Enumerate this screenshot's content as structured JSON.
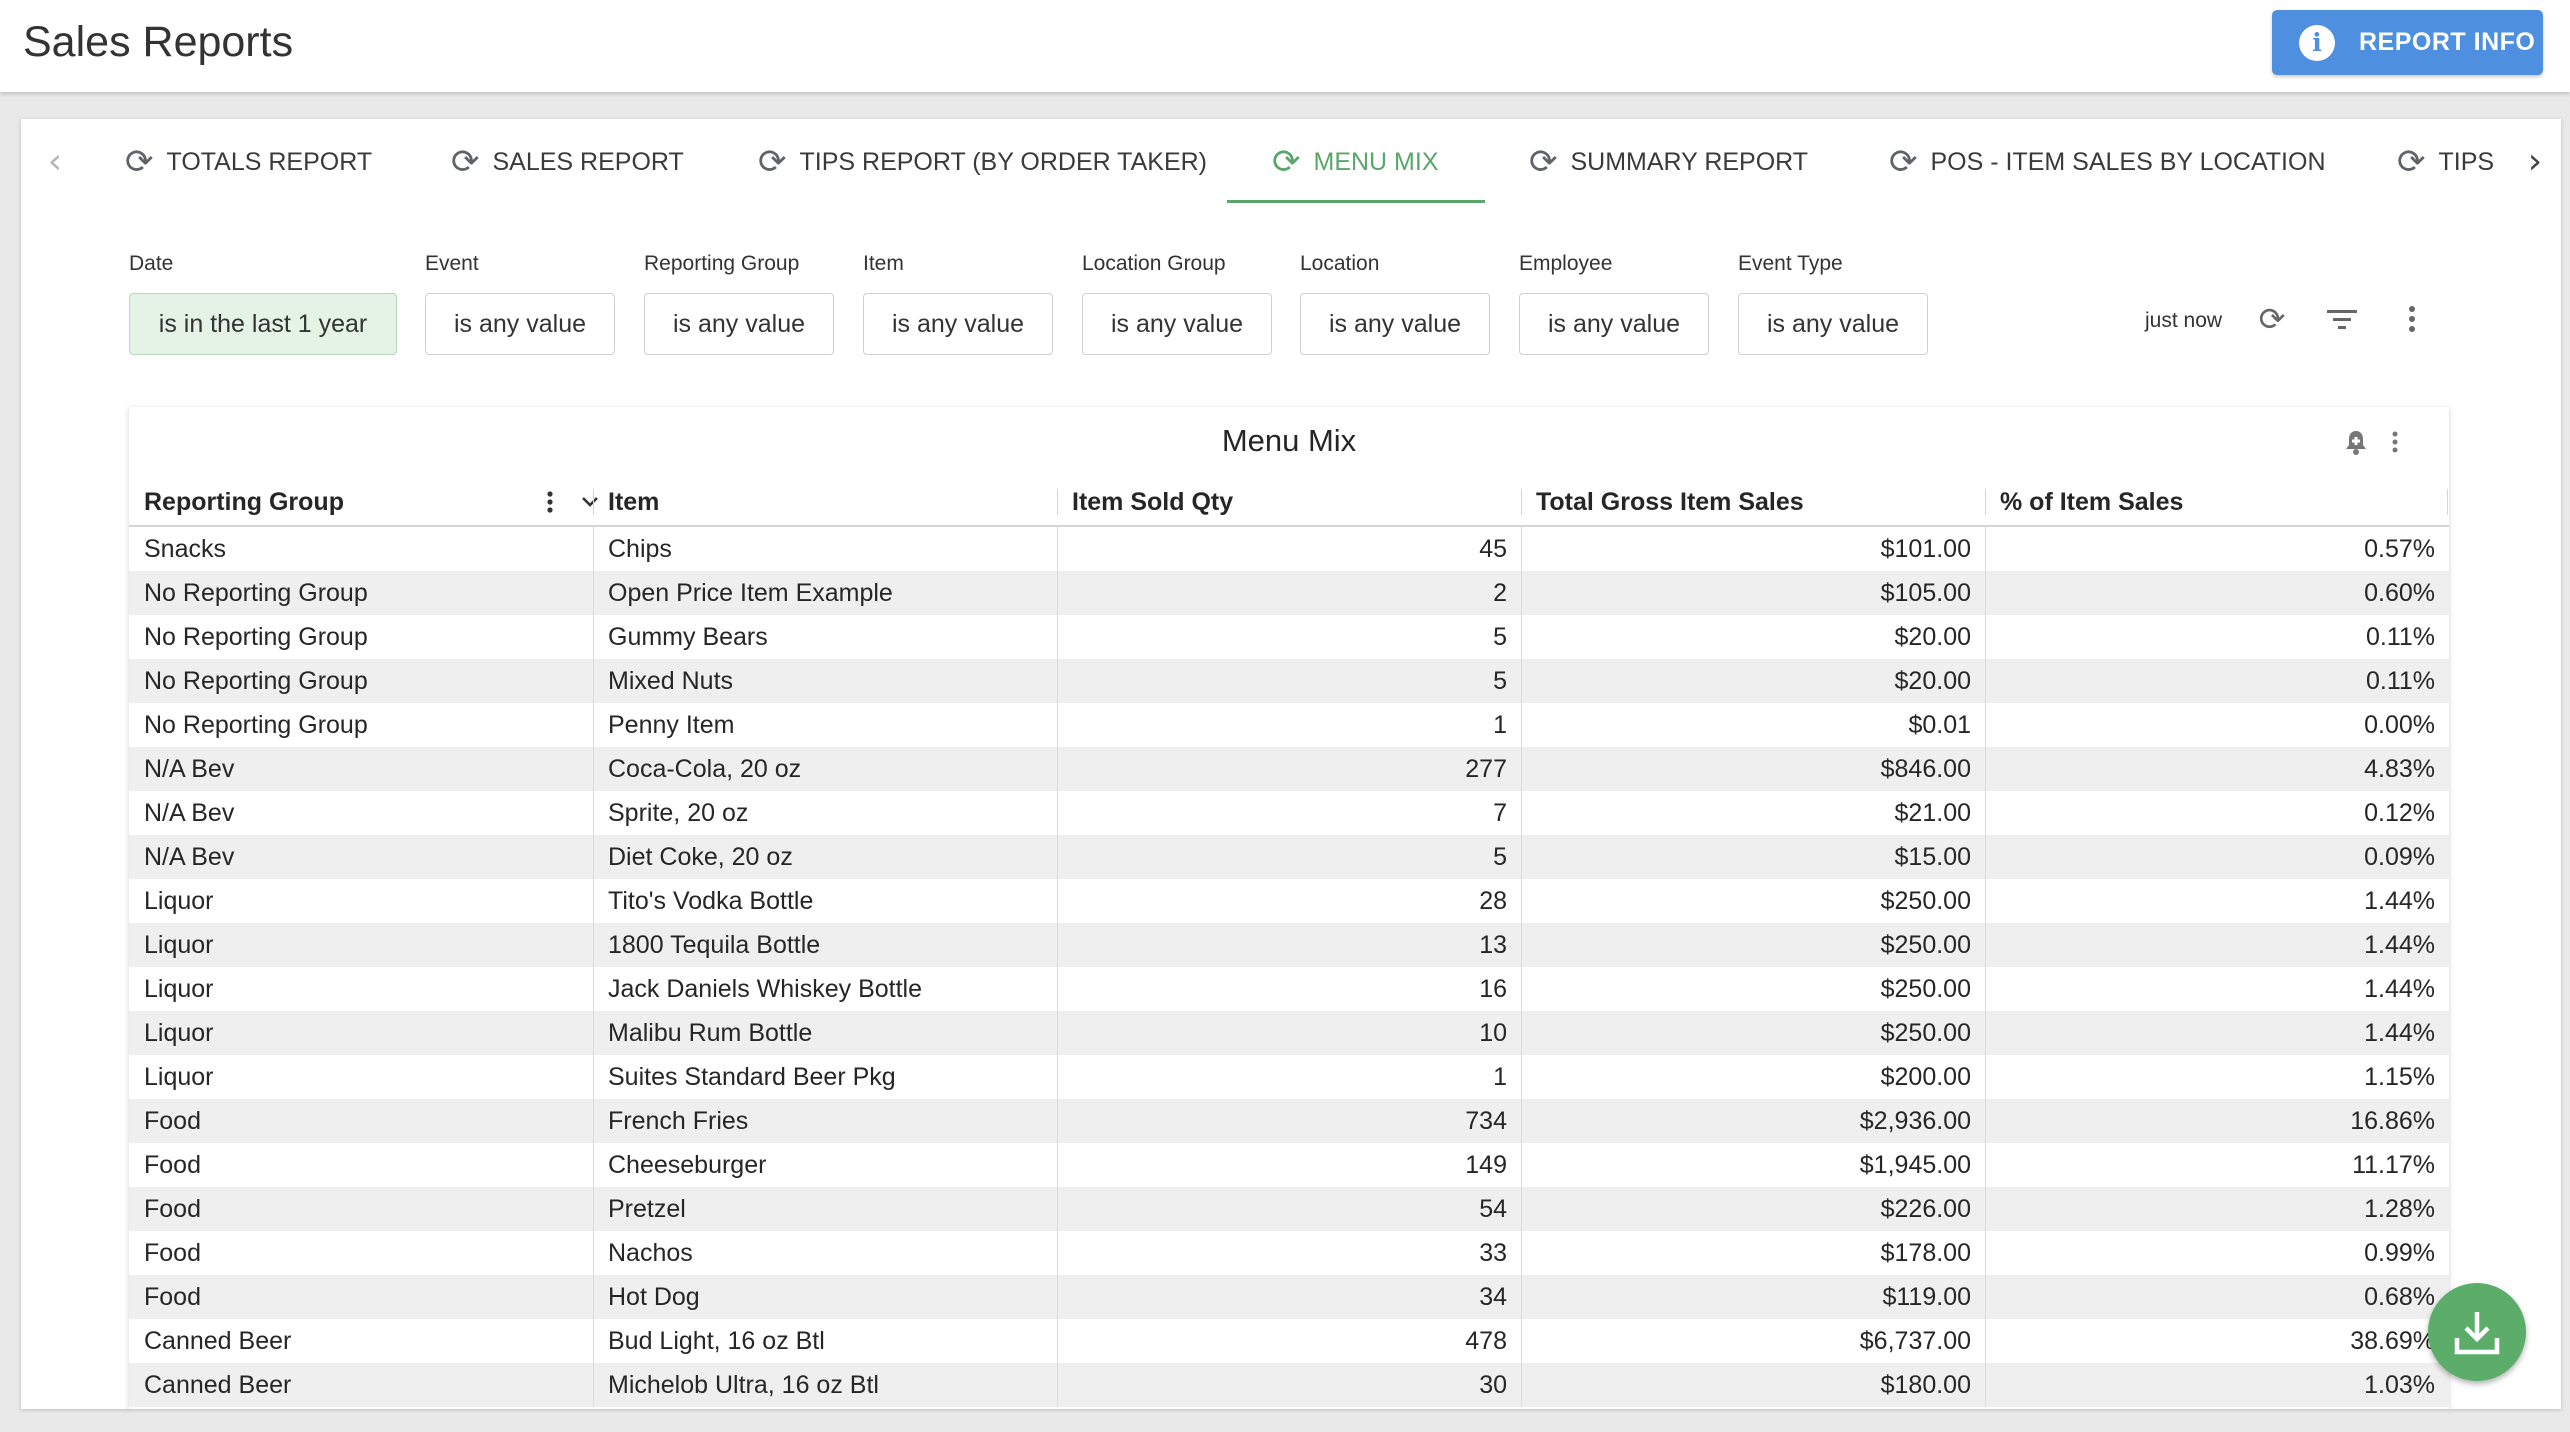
{
  "header": {
    "title": "Sales Reports",
    "report_info_label": "REPORT INFO"
  },
  "tabs": [
    {
      "label": "TOTALS REPORT",
      "active": false
    },
    {
      "label": "SALES REPORT",
      "active": false
    },
    {
      "label": "TIPS REPORT (BY ORDER TAKER)",
      "active": false
    },
    {
      "label": "MENU MIX",
      "active": true
    },
    {
      "label": "SUMMARY REPORT",
      "active": false
    },
    {
      "label": "POS - ITEM SALES BY LOCATION",
      "active": false
    },
    {
      "label": "TIPS",
      "active": false
    }
  ],
  "filters": [
    {
      "label": "Date",
      "value": "is in the last 1 year",
      "active": true
    },
    {
      "label": "Event",
      "value": "is any value",
      "active": false
    },
    {
      "label": "Reporting Group",
      "value": "is any value",
      "active": false
    },
    {
      "label": "Item",
      "value": "is any value",
      "active": false
    },
    {
      "label": "Location Group",
      "value": "is any value",
      "active": false
    },
    {
      "label": "Location",
      "value": "is any value",
      "active": false
    },
    {
      "label": "Employee",
      "value": "is any value",
      "active": false
    },
    {
      "label": "Event Type",
      "value": "is any value",
      "active": false
    }
  ],
  "toolbar": {
    "refresh_status": "just now"
  },
  "table": {
    "title": "Menu Mix",
    "columns": [
      "Reporting Group",
      "Item",
      "Item Sold Qty",
      "Total Gross Item Sales",
      "% of Item Sales"
    ],
    "rows": [
      [
        "Snacks",
        "Chips",
        "45",
        "$101.00",
        "0.57%"
      ],
      [
        "No Reporting Group",
        "Open Price Item Example",
        "2",
        "$105.00",
        "0.60%"
      ],
      [
        "No Reporting Group",
        "Gummy Bears",
        "5",
        "$20.00",
        "0.11%"
      ],
      [
        "No Reporting Group",
        "Mixed Nuts",
        "5",
        "$20.00",
        "0.11%"
      ],
      [
        "No Reporting Group",
        "Penny Item",
        "1",
        "$0.01",
        "0.00%"
      ],
      [
        "N/A Bev",
        "Coca-Cola, 20 oz",
        "277",
        "$846.00",
        "4.83%"
      ],
      [
        "N/A Bev",
        "Sprite, 20 oz",
        "7",
        "$21.00",
        "0.12%"
      ],
      [
        "N/A Bev",
        "Diet Coke, 20 oz",
        "5",
        "$15.00",
        "0.09%"
      ],
      [
        "Liquor",
        "Tito's Vodka Bottle",
        "28",
        "$250.00",
        "1.44%"
      ],
      [
        "Liquor",
        "1800 Tequila Bottle",
        "13",
        "$250.00",
        "1.44%"
      ],
      [
        "Liquor",
        "Jack Daniels Whiskey Bottle",
        "16",
        "$250.00",
        "1.44%"
      ],
      [
        "Liquor",
        "Malibu Rum Bottle",
        "10",
        "$250.00",
        "1.44%"
      ],
      [
        "Liquor",
        "Suites Standard Beer Pkg",
        "1",
        "$200.00",
        "1.15%"
      ],
      [
        "Food",
        "French Fries",
        "734",
        "$2,936.00",
        "16.86%"
      ],
      [
        "Food",
        "Cheeseburger",
        "149",
        "$1,945.00",
        "11.17%"
      ],
      [
        "Food",
        "Pretzel",
        "54",
        "$226.00",
        "1.28%"
      ],
      [
        "Food",
        "Nachos",
        "33",
        "$178.00",
        "0.99%"
      ],
      [
        "Food",
        "Hot Dog",
        "34",
        "$119.00",
        "0.68%"
      ],
      [
        "Canned Beer",
        "Bud Light, 16 oz Btl",
        "478",
        "$6,737.00",
        "38.69%"
      ],
      [
        "Canned Beer",
        "Michelob Ultra, 16 oz Btl",
        "30",
        "$180.00",
        "1.03%"
      ]
    ]
  },
  "colors": {
    "accent": "#5aa66a",
    "primary_button": "#4e8fe0",
    "active_filter_bg": "#e4f3e6"
  },
  "icons": [
    "info-icon",
    "refresh-icon",
    "chevron-left-icon",
    "chevron-right-icon",
    "filter-icon",
    "more-vert-icon",
    "bell-icon",
    "chevron-down-icon",
    "download-icon"
  ]
}
